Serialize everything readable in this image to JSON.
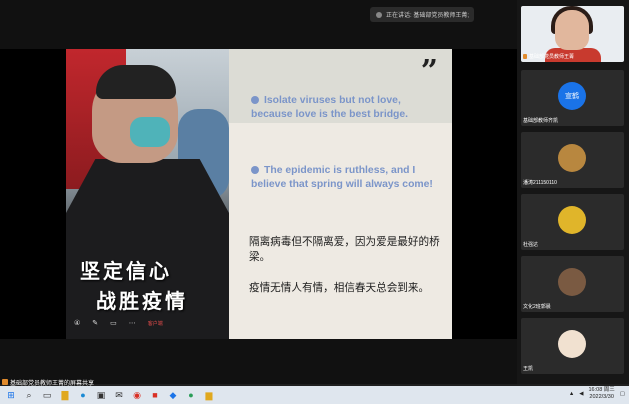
{
  "top_bar": {
    "speaking_label": "正在讲话: 基础部党员教师王菁;"
  },
  "slide": {
    "quote_mark": "”",
    "bullets": [
      "Isolate viruses but not love, because love is the best bridge.",
      "The epidemic is ruthless, and I believe that spring will always come!"
    ],
    "chinese": [
      "隔离病毒但不隔离爱，因为爱是最好的桥梁。",
      "疫情无情人有情，相信春天总会到来。"
    ],
    "poster_lines": [
      "坚定信心",
      "战胜疫情"
    ],
    "poster_controls": {
      "zoom": "④",
      "sel": "客户端"
    }
  },
  "participants": [
    {
      "name": "基础部党员教师王菁",
      "type": "camera"
    },
    {
      "name": "基础部教师齐凯",
      "type": "avatar",
      "avatar_text": "宣鹤",
      "color": "#1a73e8"
    },
    {
      "name": "潘涛211150110",
      "type": "avatar",
      "color": "#b8873f"
    },
    {
      "name": "杜强达",
      "type": "avatar",
      "color": "#e0b52a"
    },
    {
      "name": "文化2班郭晨",
      "type": "avatar",
      "color": "#7a5a42"
    },
    {
      "name": "王凯",
      "type": "avatar",
      "color": "#f1e1d0"
    }
  ],
  "share_label": "基础部党员教师王菁的屏幕共享",
  "taskbar": {
    "time": "16:08 周三",
    "date": "2022/3/30",
    "icons": [
      "windows-icon",
      "search-icon",
      "task-view-icon",
      "file-explorer-icon",
      "edge-icon",
      "store-icon",
      "mail-icon",
      "chrome-icon",
      "wps-icon",
      "meeting-icon",
      "other-app-icon",
      "folder-icon"
    ]
  }
}
